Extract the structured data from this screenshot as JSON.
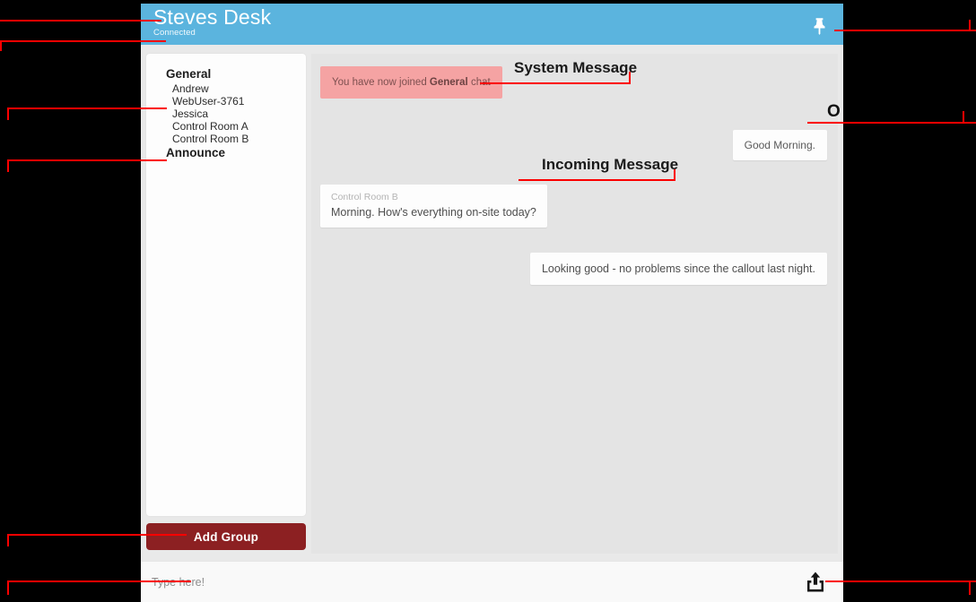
{
  "header": {
    "title": "Steves Desk",
    "status": "Connected",
    "pin_icon": "pin-icon"
  },
  "sidebar": {
    "groups": [
      {
        "name": "General",
        "members": [
          "Andrew",
          "WebUser-3761",
          "Jessica",
          "Control Room A",
          "Control Room B"
        ]
      },
      {
        "name": "Announce",
        "members": []
      }
    ],
    "add_group_label": "Add Group"
  },
  "chat": {
    "messages": [
      {
        "kind": "system",
        "text_before": "You have now joined ",
        "text_bold": "General",
        "text_after": " chat"
      },
      {
        "kind": "outgoing",
        "text": "Good Morning."
      },
      {
        "kind": "incoming",
        "sender": "Control Room B",
        "text": "Morning. How's everything on-site today?"
      },
      {
        "kind": "outgoing_plain",
        "text": "Looking good - no problems since the callout last night."
      }
    ]
  },
  "composer": {
    "placeholder": "Type here!",
    "value": "",
    "send_icon": "share-upload-icon"
  },
  "annotations": {
    "system_message": "System Message",
    "incoming_message": "Incoming Message",
    "outgoing_message": "O",
    "line_color": "#fb0000"
  },
  "colors": {
    "header_blue": "#5bb4de",
    "system_pink": "#f5a3a3",
    "add_group_red": "#8c2022",
    "chat_bg": "#e4e4e4",
    "app_bg": "#e9e9e9",
    "card_white": "#fdfdfd",
    "page_bg": "#000000"
  }
}
